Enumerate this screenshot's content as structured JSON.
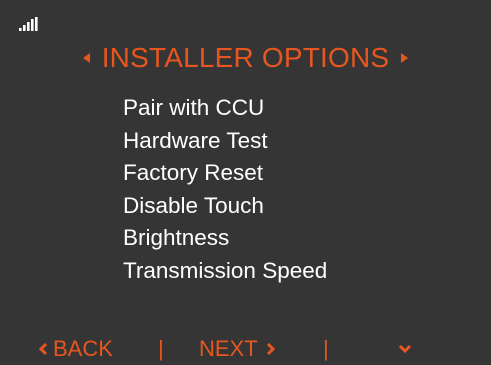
{
  "status": {
    "signal_icon": "signal-bars-icon"
  },
  "header": {
    "title": "INSTALLER OPTIONS",
    "prev_icon": "triangle-left-icon",
    "next_icon": "triangle-right-icon"
  },
  "menu": {
    "items": [
      {
        "label": "Pair with CCU"
      },
      {
        "label": "Hardware Test"
      },
      {
        "label": "Factory Reset"
      },
      {
        "label": "Disable Touch"
      },
      {
        "label": "Brightness"
      },
      {
        "label": "Transmission Speed"
      }
    ]
  },
  "footer": {
    "back_label": "BACK",
    "next_label": "NEXT",
    "separator": "|",
    "down_icon": "chevron-down-icon"
  },
  "colors": {
    "background": "#353535",
    "accent": "#e8561f",
    "text": "#ffffff"
  }
}
